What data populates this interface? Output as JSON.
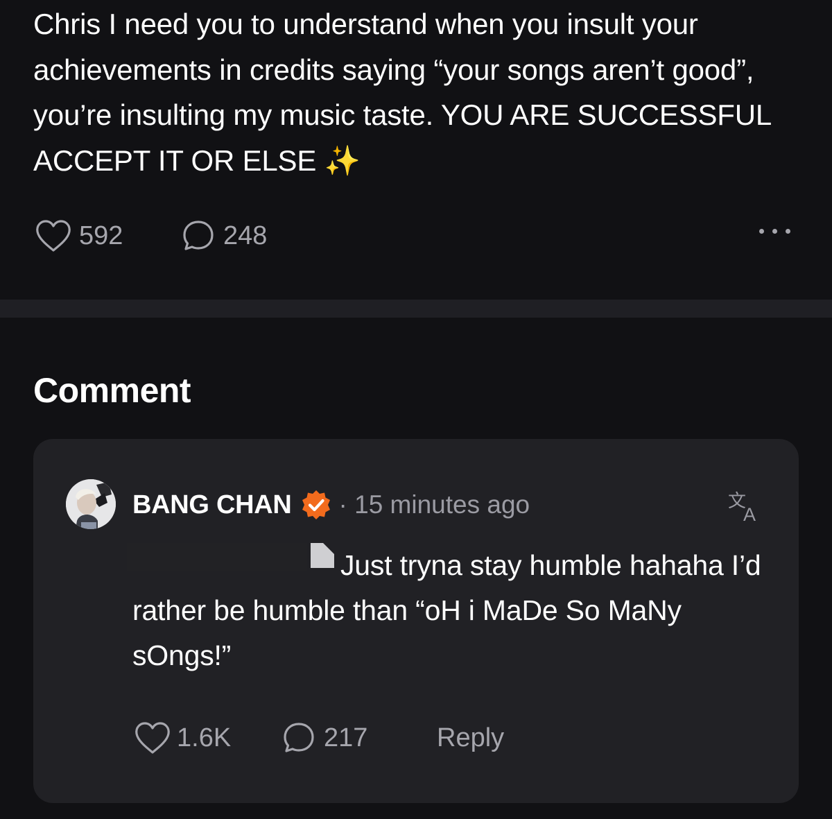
{
  "post": {
    "text": "Chris I need you to understand when you insult your achievements in credits saying “your songs aren’t good”, you’re insulting my music taste. YOU ARE SUCCESSFUL ACCEPT IT OR ELSE ✨",
    "likes": "592",
    "comments": "248"
  },
  "comment_section": {
    "title": "Comment",
    "comment": {
      "author": "BANG CHAN",
      "meta": "· 15 minutes ago",
      "text": "Just tryna stay humble hahaha I’d rather be humble than “oH i MaDe So MaNy sOngs!”",
      "likes": "1.6K",
      "replies": "217",
      "reply_label": "Reply"
    }
  },
  "colors": {
    "background": "#111114",
    "card": "#212125",
    "muted_text": "#a6a6ad",
    "verified_badge": "#f26b1d"
  },
  "icons": [
    "heart-icon",
    "comment-bubble-icon",
    "more-dots-icon",
    "verified-badge-icon",
    "translate-icon",
    "document-icon"
  ]
}
